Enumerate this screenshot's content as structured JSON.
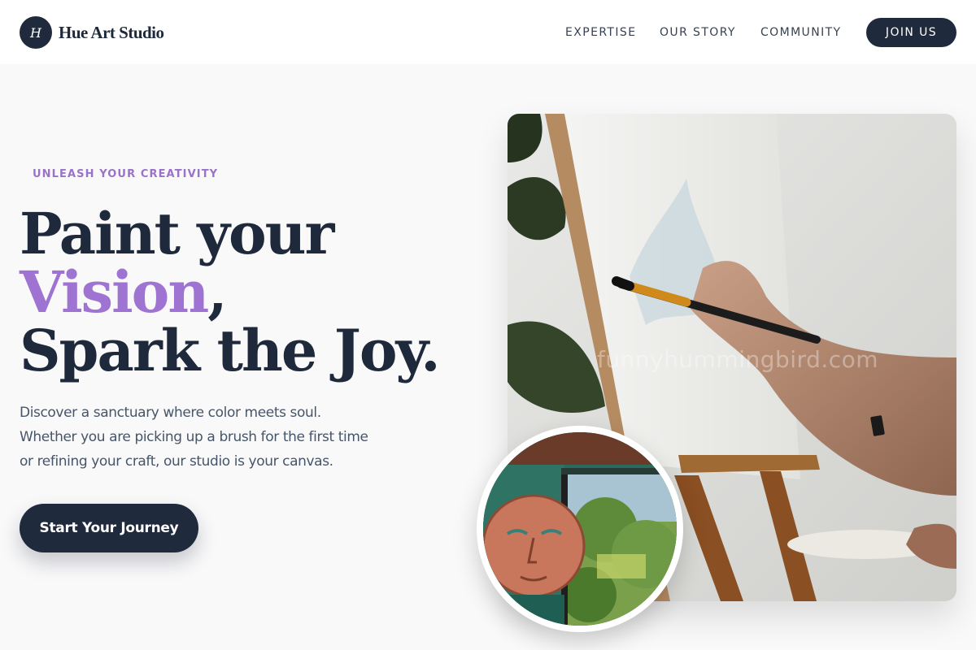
{
  "brand": {
    "logo_letter": "H",
    "name": "Hue Art Studio"
  },
  "nav": {
    "items": [
      "EXPERTISE",
      "OUR STORY",
      "COMMUNITY"
    ],
    "cta": "JOIN US"
  },
  "hero": {
    "eyebrow": "UNLEASH YOUR CREATIVITY",
    "headline_line1": "Paint your",
    "headline_accent": "Vision",
    "headline_comma": ",",
    "headline_line3": "Spark the Joy.",
    "description": [
      "Discover a sanctuary where color meets soul.",
      "Whether you are picking up a brush for the first time",
      "or refining your craft, our studio is your canvas."
    ],
    "cta": "Start Your Journey"
  },
  "images": {
    "main_alt": "Hand painting on a canvas at an easel",
    "watermark": "funnyhummingbird.com",
    "inset_alt": "Painted face artwork beside an open window"
  },
  "colors": {
    "brand_dark": "#1f2a3d",
    "accent_purple": "#9e73d2",
    "eyebrow_purple": "#9b72c9",
    "background": "#f9f9fa"
  }
}
